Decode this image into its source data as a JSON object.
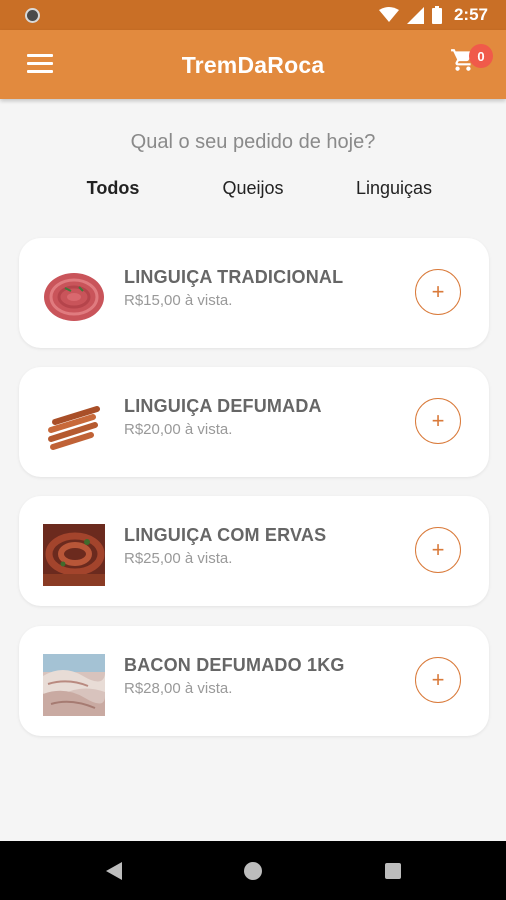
{
  "status_bar": {
    "time": "2:57",
    "icons": [
      "wifi-icon",
      "signal-icon",
      "battery-icon"
    ]
  },
  "app_bar": {
    "title": "TremDaRoca",
    "menu_icon": "hamburger-menu-icon",
    "cart_icon": "shopping-cart-icon",
    "cart_count": "0"
  },
  "main": {
    "question": "Qual o seu pedido de hoje?",
    "tabs": [
      {
        "label": "Todos",
        "active": true
      },
      {
        "label": "Queijos",
        "active": false
      },
      {
        "label": "Linguiças",
        "active": false
      }
    ],
    "products": [
      {
        "name": "LINGUIÇA TRADICIONAL",
        "price": "R$15,00 à vista.",
        "image": "sausage-coil-image"
      },
      {
        "name": "LINGUIÇA DEFUMADA",
        "price": "R$20,00 à vista.",
        "image": "smoked-sausage-sticks-image"
      },
      {
        "name": "LINGUIÇA COM ERVAS",
        "price": "R$25,00 à vista.",
        "image": "herb-sausage-photo"
      },
      {
        "name": "BACON DEFUMADO 1KG",
        "price": "R$28,00 à vista.",
        "image": "smoked-bacon-photo"
      }
    ],
    "add_label": "+"
  },
  "nav_bar": {
    "icons": [
      "back-icon",
      "home-icon",
      "recents-icon"
    ]
  },
  "colors": {
    "primary": "#e28a3e",
    "status_bar": "#c96f26",
    "badge": "#f05a4a",
    "accent": "#d97a3a",
    "background": "#f5f5f5"
  }
}
